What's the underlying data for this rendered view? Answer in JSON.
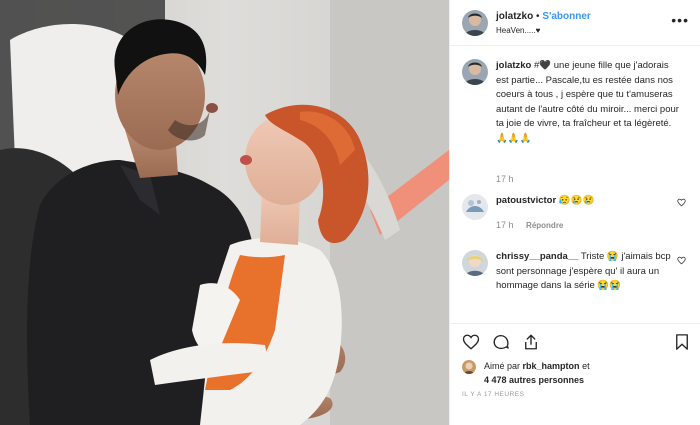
{
  "post": {
    "username": "jolatzko",
    "separator": "•",
    "follow_label": "S'abonner",
    "location": "HeaVen.....♥",
    "more_icon": "more-icon"
  },
  "caption": {
    "username": "jolatzko",
    "text": "#🖤 une jeune fille que j'adorais est partie... Pascale,tu es restée dans nos coeurs à tous , j espère que tu t'amuseras autant de l'autre côté du miroir... merci pour ta joie de vivre, ta fraîcheur et ta légèreté. 🙏🙏🙏",
    "time": "17 h"
  },
  "comments": [
    {
      "username": "patoustvictor",
      "text": "😥😢😢",
      "time": "17 h",
      "reply_label": "Répondre"
    },
    {
      "username": "chrissy__panda__",
      "text": "Triste 😭 j'aimais bcp sont personnage j'espère qu' il aura un hommage dans la série 😭😭"
    }
  ],
  "likes": {
    "prefix": "Aimé par",
    "user": "rbk_hampton",
    "suffix": "et",
    "others": "4 478 autres personnes"
  },
  "timestamp": "IL Y A 17 HEURES",
  "colors": {
    "accent": "#3897f0",
    "text": "#262626",
    "muted": "#8e8e8e",
    "border": "#efefef",
    "hair": "#d6592b"
  }
}
